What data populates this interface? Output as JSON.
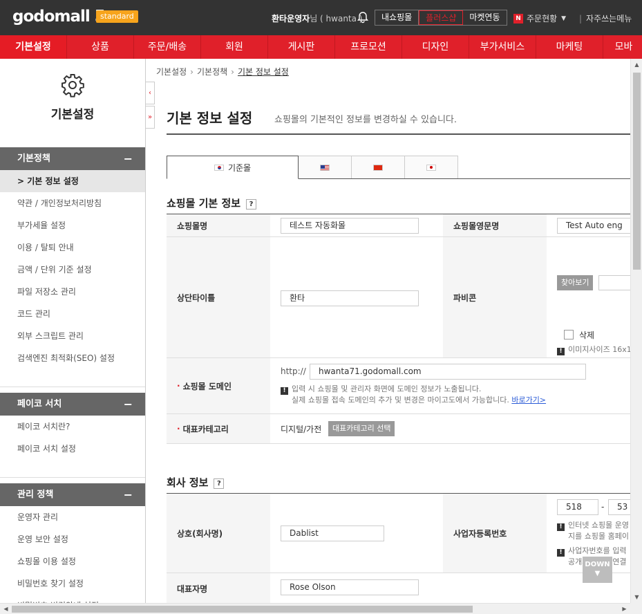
{
  "header": {
    "logo_text": "godomall 5",
    "logo_badge": "standard",
    "user_name": "환타운영자",
    "user_suffix": "님 ( hwanta )",
    "top_buttons": [
      "내쇼핑몰",
      "플러스샵",
      "마켓연동"
    ],
    "order_status_badge": "N",
    "order_status": "주문현황",
    "frequent_menu": "자주쓰는메뉴"
  },
  "main_nav": [
    "기본설정",
    "상품",
    "주문/배송",
    "회원",
    "게시판",
    "프로모션",
    "디자인",
    "부가서비스",
    "마케팅",
    "모바"
  ],
  "sidebar": {
    "title": "기본설정",
    "groups": [
      {
        "label": "기본정책",
        "items": [
          "> 기본 정보 설정",
          "약관 / 개인정보처리방침",
          "부가세율 설정",
          "이용 / 탈퇴 안내",
          "금액 / 단위 기준 설정",
          "파일 저장소 관리",
          "코드 관리",
          "외부 스크립트 관리",
          "검색엔진 최적화(SEO) 설정"
        ]
      },
      {
        "label": "페이코 서치",
        "items": [
          "페이코 서치란?",
          "페이코 서치 설정"
        ]
      },
      {
        "label": "관리 정책",
        "items": [
          "운영자 관리",
          "운영 보안 설정",
          "쇼핑몰 이용 설정",
          "비밀번호 찾기 설정",
          "비밀번호 변경안내 설정"
        ]
      }
    ],
    "collapse_icon": "−"
  },
  "collapse_tabs": [
    "‹",
    "»"
  ],
  "breadcrumb": [
    "기본설정",
    "기본정책",
    "기본 정보 설정"
  ],
  "page": {
    "title": "기본 정보 설정",
    "description": "쇼핑몰의 기본적인 정보를 변경하실 수 있습니다."
  },
  "lang_tabs": {
    "first_label": "기준몰"
  },
  "section1": {
    "title": "쇼핑몰 기본 정보",
    "help": "?",
    "mall_name_label": "쇼핑몰명",
    "mall_name_value": "테스트 자동화몰",
    "mall_eng_label": "쇼핑몰영문명",
    "mall_eng_value": "Test Auto eng",
    "top_title_label": "상단타이틀",
    "top_title_value": "환타",
    "favicon_label": "파비콘",
    "find_button": "찾아보기",
    "delete_label": "삭제",
    "favicon_note": "이미지사이즈 16x1",
    "domain_label": "쇼핑몰 도메인",
    "domain_prefix": "http://",
    "domain_value": "hwanta71.godomall.com",
    "domain_note1": "입력 시 쇼핑몰 및 관리자 화면에 도메인 정보가 노출됩니다.",
    "domain_note2": "실제 쇼핑몰 접속 도메인의 추가 및 변경은 마이고도에서 가능합니다.",
    "domain_link": "바로가기>",
    "category_label": "대표카테고리",
    "category_value": "디지털/가전",
    "category_button": "대표카테고리 선택"
  },
  "section2": {
    "title": "회사 정보",
    "help": "?",
    "company_label": "상호(회사명)",
    "company_value": "Dablist",
    "bizno_label": "사업자등록번호",
    "bizno_part1": "518",
    "bizno_dash": "-",
    "bizno_part2": "53",
    "bizno_note1a": "인터넷 쇼핑몰 운영",
    "bizno_note1b": "지를 쇼핑몰 홈페이",
    "bizno_note2a": "사업자번호를 입력",
    "bizno_note2b": "공개페이지가 연결",
    "ceo_label": "대표자명",
    "ceo_value": "Rose Olson"
  },
  "down_button": "DOWN"
}
